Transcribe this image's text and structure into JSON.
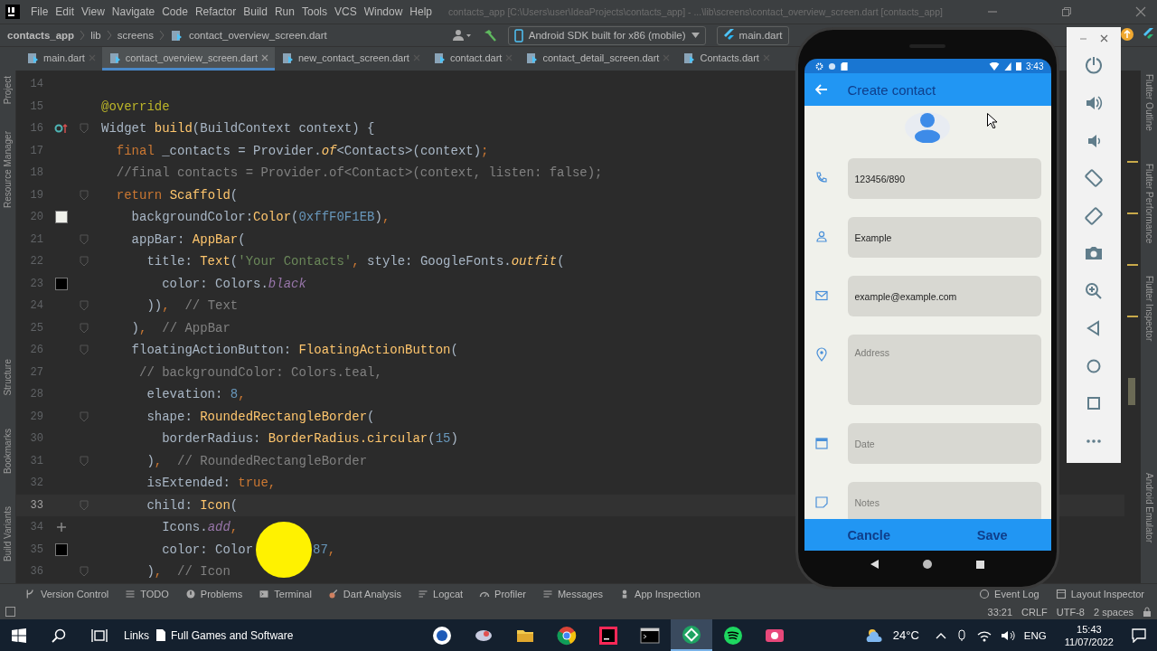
{
  "menu": [
    "File",
    "Edit",
    "View",
    "Navigate",
    "Code",
    "Refactor",
    "Build",
    "Run",
    "Tools",
    "VCS",
    "Window",
    "Help"
  ],
  "window": {
    "title": "contacts_app [C:\\Users\\user\\IdeaProjects\\contacts_app] - ...\\lib\\screens\\contact_overview_screen.dart [contacts_app]"
  },
  "breadcrumb": [
    {
      "label": "contacts_app",
      "kind": "project"
    },
    {
      "label": "lib",
      "kind": "folder"
    },
    {
      "label": "screens",
      "kind": "folder"
    },
    {
      "label": "contact_overview_screen.dart",
      "kind": "file"
    }
  ],
  "run_config": {
    "device": "Android SDK built for x86 (mobile)",
    "target": "main.dart"
  },
  "tabs": [
    {
      "label": "main.dart",
      "selected": false
    },
    {
      "label": "contact_overview_screen.dart",
      "selected": true
    },
    {
      "label": "new_contact_screen.dart",
      "selected": false
    },
    {
      "label": "contact.dart",
      "selected": false
    },
    {
      "label": "contact_detail_screen.dart",
      "selected": false
    },
    {
      "label": "Contacts.dart",
      "selected": false
    }
  ],
  "left_tools": {
    "top": [
      "Project",
      "Resource Manager"
    ],
    "bottom": [
      "Structure",
      "Bookmarks",
      "Build Variants"
    ]
  },
  "right_tools": [
    "Flutter Outline",
    "Flutter Performance",
    "Flutter Inspector",
    "Android Emulator"
  ],
  "code": [
    {
      "number": "14",
      "fold": false,
      "current": false
    },
    {
      "number": "15",
      "fold": false,
      "current": false,
      "tokens": [
        {
          "kind": "annotation",
          "text": "@override"
        }
      ]
    },
    {
      "number": "16",
      "fold": true,
      "current": false,
      "mark": {
        "kind": "override"
      },
      "tokens": [
        {
          "kind": "plain",
          "text": "Widget "
        },
        {
          "kind": "fn",
          "text": "build"
        },
        {
          "kind": "plain",
          "text": "(BuildContext context) {"
        }
      ]
    },
    {
      "number": "17",
      "fold": false,
      "current": false,
      "tokens": [
        {
          "kind": "keyword",
          "text": "  final"
        },
        {
          "kind": "plain",
          "text": " _contacts = Provider."
        },
        {
          "kind": "ifn",
          "text": "of"
        },
        {
          "kind": "plain",
          "text": "<Contacts>(context)"
        },
        {
          "kind": "keyword",
          "text": ";"
        }
      ]
    },
    {
      "number": "18",
      "fold": false,
      "current": false,
      "tokens": [
        {
          "kind": "comment",
          "text": "  //final contacts = Provider.of<Contact>(context, listen: false);"
        }
      ]
    },
    {
      "number": "19",
      "fold": true,
      "current": false,
      "tokens": [
        {
          "kind": "keyword",
          "text": "  return "
        },
        {
          "kind": "fn",
          "text": "Scaffold"
        },
        {
          "kind": "plain",
          "text": "("
        }
      ]
    },
    {
      "number": "20",
      "fold": false,
      "current": false,
      "mark": {
        "kind": "swatch",
        "color": "#f0f1eb"
      },
      "tokens": [
        {
          "kind": "plain",
          "text": "    backgroundColor:"
        },
        {
          "kind": "fn",
          "text": "Color"
        },
        {
          "kind": "plain",
          "text": "("
        },
        {
          "kind": "number",
          "text": "0xffF0F1EB"
        },
        {
          "kind": "plain",
          "text": ")"
        },
        {
          "kind": "keyword",
          "text": ","
        }
      ]
    },
    {
      "number": "21",
      "fold": true,
      "current": false,
      "tokens": [
        {
          "kind": "plain",
          "text": "    appBar: "
        },
        {
          "kind": "fn",
          "text": "AppBar"
        },
        {
          "kind": "plain",
          "text": "("
        }
      ]
    },
    {
      "number": "22",
      "fold": true,
      "current": false,
      "tokens": [
        {
          "kind": "plain",
          "text": "      title: "
        },
        {
          "kind": "fn",
          "text": "Text"
        },
        {
          "kind": "plain",
          "text": "("
        },
        {
          "kind": "string",
          "text": "'Your Contacts'"
        },
        {
          "kind": "keyword",
          "text": ","
        },
        {
          "kind": "plain",
          "text": " style: GoogleFonts."
        },
        {
          "kind": "ifn",
          "text": "outfit"
        },
        {
          "kind": "plain",
          "text": "("
        }
      ]
    },
    {
      "number": "23",
      "fold": false,
      "current": false,
      "mark": {
        "kind": "swatch",
        "color": "#000000"
      },
      "tokens": [
        {
          "kind": "plain",
          "text": "        color: Colors."
        },
        {
          "kind": "const",
          "text": "black"
        }
      ]
    },
    {
      "number": "24",
      "fold": true,
      "current": false,
      "tokens": [
        {
          "kind": "plain",
          "text": "      ))"
        },
        {
          "kind": "keyword",
          "text": ","
        },
        {
          "kind": "comment",
          "text": "  // Text"
        }
      ]
    },
    {
      "number": "25",
      "fold": true,
      "current": false,
      "tokens": [
        {
          "kind": "plain",
          "text": "    )"
        },
        {
          "kind": "keyword",
          "text": ","
        },
        {
          "kind": "comment",
          "text": "  // AppBar"
        }
      ]
    },
    {
      "number": "26",
      "fold": true,
      "current": false,
      "tokens": [
        {
          "kind": "plain",
          "text": "    floatingActionButton: "
        },
        {
          "kind": "fn",
          "text": "FloatingActionButton"
        },
        {
          "kind": "plain",
          "text": "("
        }
      ]
    },
    {
      "number": "27",
      "fold": false,
      "current": false,
      "tokens": [
        {
          "kind": "comment",
          "text": "     // backgroundColor: Colors.teal,"
        }
      ]
    },
    {
      "number": "28",
      "fold": false,
      "current": false,
      "tokens": [
        {
          "kind": "plain",
          "text": "      elevation: "
        },
        {
          "kind": "number",
          "text": "8"
        },
        {
          "kind": "keyword",
          "text": ","
        }
      ]
    },
    {
      "number": "29",
      "fold": true,
      "current": false,
      "tokens": [
        {
          "kind": "plain",
          "text": "      shape: "
        },
        {
          "kind": "fn",
          "text": "RoundedRectangleBorder"
        },
        {
          "kind": "plain",
          "text": "("
        }
      ]
    },
    {
      "number": "30",
      "fold": false,
      "current": false,
      "tokens": [
        {
          "kind": "plain",
          "text": "        borderRadius: "
        },
        {
          "kind": "fn",
          "text": "BorderRadius.circular"
        },
        {
          "kind": "plain",
          "text": "("
        },
        {
          "kind": "number",
          "text": "15"
        },
        {
          "kind": "plain",
          "text": ")"
        }
      ]
    },
    {
      "number": "31",
      "fold": true,
      "current": false,
      "tokens": [
        {
          "kind": "plain",
          "text": "      )"
        },
        {
          "kind": "keyword",
          "text": ","
        },
        {
          "kind": "comment",
          "text": "  // RoundedRectangleBorder"
        }
      ]
    },
    {
      "number": "32",
      "fold": false,
      "current": false,
      "tokens": [
        {
          "kind": "plain",
          "text": "      isExtended: "
        },
        {
          "kind": "keyword",
          "text": "true"
        },
        {
          "kind": "keyword",
          "text": ","
        }
      ]
    },
    {
      "number": "33",
      "fold": true,
      "current": true,
      "tokens": [
        {
          "kind": "plain",
          "text": "      child: "
        },
        {
          "kind": "fn",
          "text": "Icon"
        },
        {
          "kind": "plain",
          "text": "("
        }
      ]
    },
    {
      "number": "34",
      "fold": false,
      "current": false,
      "mark": {
        "kind": "add"
      },
      "tokens": [
        {
          "kind": "plain",
          "text": "        Icons."
        },
        {
          "kind": "const",
          "text": "add"
        },
        {
          "kind": "keyword",
          "text": ","
        }
      ]
    },
    {
      "number": "35",
      "fold": false,
      "current": false,
      "mark": {
        "kind": "swatch",
        "color": "#000000"
      },
      "tokens": [
        {
          "kind": "plain",
          "text": "        color: Color"
        },
        {
          "kind": "highlight"
        },
        {
          "kind": "number",
          "text": "87"
        },
        {
          "kind": "keyword",
          "text": ","
        }
      ]
    },
    {
      "number": "36",
      "fold": true,
      "current": false,
      "tokens": [
        {
          "kind": "plain",
          "text": "      )"
        },
        {
          "kind": "keyword",
          "text": ","
        },
        {
          "kind": "comment",
          "text": "  // Icon"
        }
      ]
    }
  ],
  "phone": {
    "time": "3:43",
    "title": "Create contact",
    "fields": [
      {
        "kind": "phone",
        "value": "123456/890",
        "multiline": false
      },
      {
        "kind": "person",
        "value": "Example",
        "multiline": false
      },
      {
        "kind": "email",
        "value": "example@example.com",
        "multiline": false
      },
      {
        "kind": "location",
        "placeholder": "Address",
        "multiline": true
      },
      {
        "kind": "calendar",
        "placeholder": "Date",
        "multiline": false
      },
      {
        "kind": "note",
        "placeholder": "Notes",
        "multiline": false
      }
    ],
    "actions": [
      "Cancle",
      "Save"
    ]
  },
  "tool_windows": {
    "left": [
      "Version Control",
      "TODO",
      "Problems",
      "Terminal",
      "Dart Analysis",
      "Logcat",
      "Profiler",
      "Messages",
      "App Inspection"
    ],
    "right": [
      "Event Log",
      "Layout Inspector"
    ]
  },
  "status_bar": [
    "33:21",
    "CRLF",
    "UTF-8",
    "2 spaces"
  ],
  "taskbar": {
    "links": "Links",
    "folder": "Full Games and Software",
    "apps": [
      {
        "selected": false
      },
      {
        "selected": false
      },
      {
        "selected": false
      },
      {
        "selected": false
      },
      {
        "selected": false
      },
      {
        "selected": false
      },
      {
        "selected": true
      },
      {
        "selected": false
      },
      {
        "selected": false
      }
    ],
    "temperature": "24°C",
    "language": "ENG",
    "time": "15:43",
    "date": "11/07/2022"
  }
}
